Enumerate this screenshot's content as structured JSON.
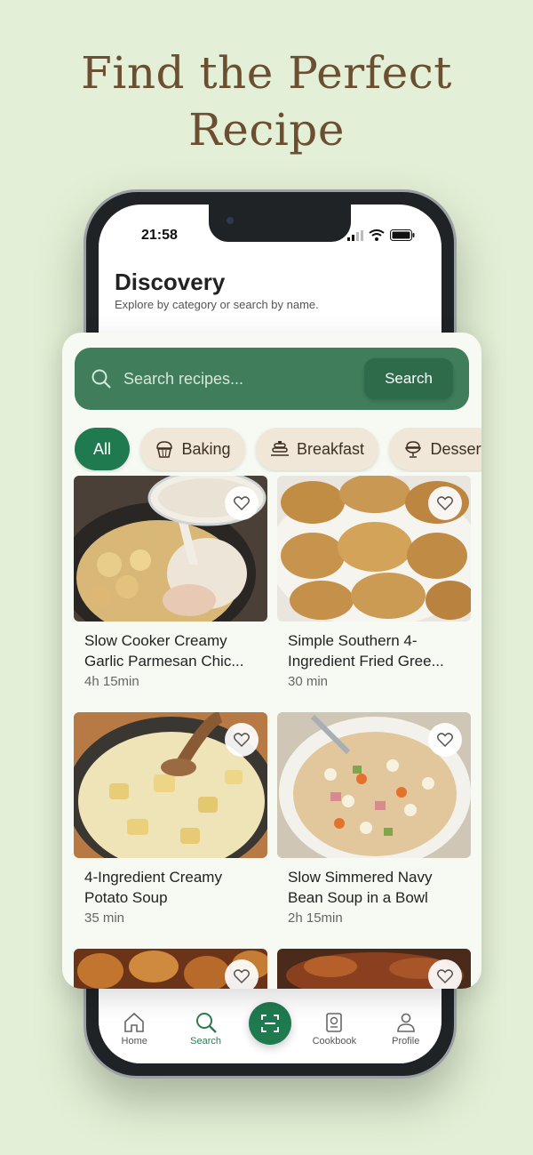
{
  "headline": {
    "line1": "Find the Perfect",
    "line2": "Recipe"
  },
  "status": {
    "time": "21:58"
  },
  "discovery": {
    "title": "Discovery",
    "subtitle": "Explore by category or search by name."
  },
  "search": {
    "placeholder": "Search recipes...",
    "button": "Search"
  },
  "categories": [
    {
      "label": "All",
      "active": true
    },
    {
      "label": "Baking",
      "icon": "muffin-icon"
    },
    {
      "label": "Breakfast",
      "icon": "pancakes-icon"
    },
    {
      "label": "Dessert",
      "icon": "sundae-icon"
    }
  ],
  "recipes": [
    {
      "title": "Slow Cooker Creamy Garlic Parmesan Chic...",
      "time": "4h 15min"
    },
    {
      "title": "Simple Southern 4-Ingredient Fried Gree...",
      "time": "30 min"
    },
    {
      "title": "4-Ingredient Creamy Potato Soup",
      "time": "35 min"
    },
    {
      "title": "Slow Simmered Navy Bean Soup in a Bowl",
      "time": "2h 15min"
    }
  ],
  "tabs": [
    {
      "label": "Home",
      "icon": "home-icon"
    },
    {
      "label": "Search",
      "icon": "search-icon",
      "active": true
    },
    {
      "label": "",
      "icon": "scan-icon"
    },
    {
      "label": "Cookbook",
      "icon": "cookbook-icon"
    },
    {
      "label": "Profile",
      "icon": "profile-icon"
    }
  ],
  "colors": {
    "accent": "#1f7a4f",
    "search_bg": "#3f7d5b",
    "chip_bg": "#f0e7d8",
    "headline": "#6b4f30",
    "background": "#e3efd6"
  }
}
